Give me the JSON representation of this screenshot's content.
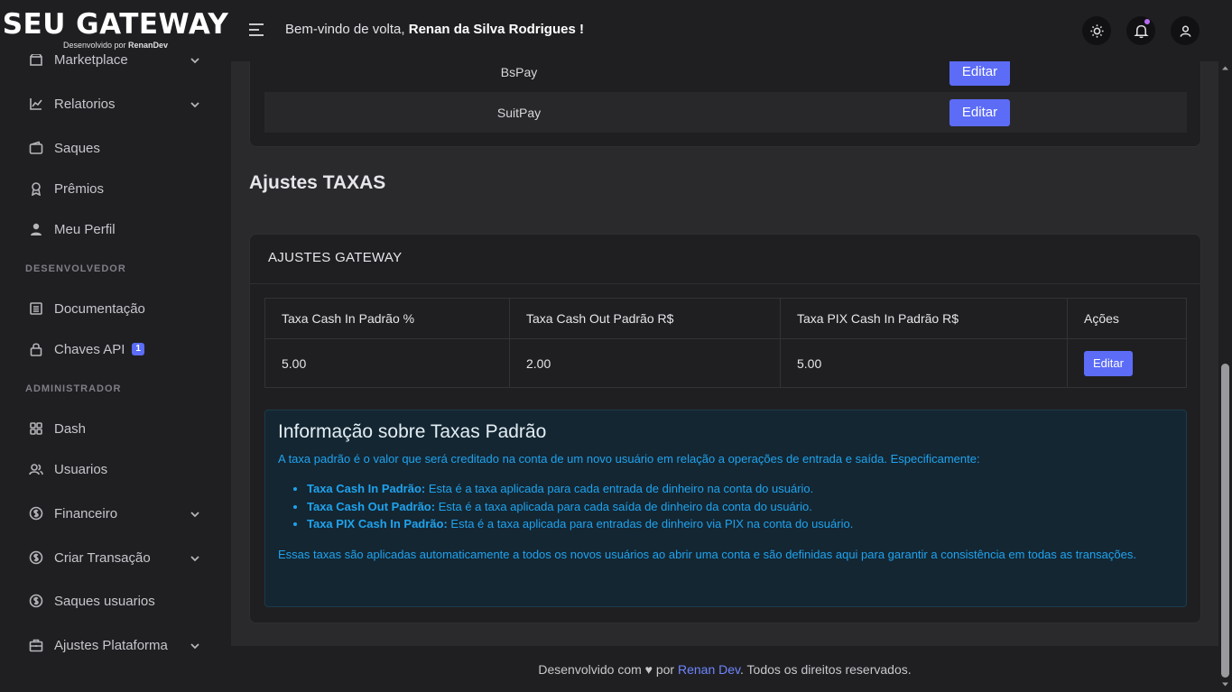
{
  "brand": {
    "title": "SEU GATEWAY",
    "subtitle_prefix": "Desenvolvido por ",
    "subtitle_author": "RenanDev"
  },
  "sidebar": {
    "items": [
      {
        "label": "Marketplace",
        "icon": "store-icon",
        "has_chevron": true
      },
      {
        "label": "Relatorios",
        "icon": "chart-line-icon",
        "has_chevron": true
      },
      {
        "label": "Saques",
        "icon": "wallet-icon",
        "has_chevron": false
      },
      {
        "label": "Prêmios",
        "icon": "award-icon",
        "has_chevron": false
      },
      {
        "label": "Meu Perfil",
        "icon": "user-icon",
        "has_chevron": false
      }
    ],
    "section_dev": "DESENVOLVEDOR",
    "dev_items": [
      {
        "label": "Documentação",
        "icon": "document-icon"
      },
      {
        "label": "Chaves API",
        "icon": "lock-icon",
        "badge": "1"
      }
    ],
    "section_admin": "ADMINISTRADOR",
    "admin_items": [
      {
        "label": "Dash",
        "icon": "grid-icon",
        "has_chevron": false
      },
      {
        "label": "Usuarios",
        "icon": "users-icon",
        "has_chevron": false
      },
      {
        "label": "Financeiro",
        "icon": "dollar-circle-icon",
        "has_chevron": true
      },
      {
        "label": "Criar Transação",
        "icon": "dollar-circle-icon",
        "has_chevron": true
      },
      {
        "label": "Saques usuarios",
        "icon": "dollar-circle-icon",
        "has_chevron": false
      },
      {
        "label": "Ajustes Plataforma",
        "icon": "briefcase-icon",
        "has_chevron": true
      }
    ]
  },
  "topbar": {
    "welcome_prefix": "Bem-vindo de volta, ",
    "user_name": "Renan da Silva Rodrigues",
    "welcome_suffix": " !"
  },
  "gateways": [
    {
      "name": "BsPay",
      "action": "Editar"
    },
    {
      "name": "SuitPay",
      "action": "Editar"
    }
  ],
  "page_heading": "Ajustes TAXAS",
  "fees_card": {
    "title": "AJUSTES GATEWAY",
    "headers": [
      "Taxa Cash In Padrão %",
      "Taxa Cash Out Padrão R$",
      "Taxa PIX Cash In Padrão R$",
      "Ações"
    ],
    "row": [
      "5.00",
      "2.00",
      "5.00"
    ],
    "action": "Editar"
  },
  "info": {
    "title": "Informação sobre Taxas Padrão",
    "intro": "A taxa padrão é o valor que será creditado na conta de um novo usuário em relação a operações de entrada e saída. Especificamente:",
    "items": [
      {
        "term": "Taxa Cash In Padrão:",
        "text": " Esta é a taxa aplicada para cada entrada de dinheiro na conta do usuário."
      },
      {
        "term": "Taxa Cash Out Padrão:",
        "text": " Esta é a taxa aplicada para cada saída de dinheiro da conta do usuário."
      },
      {
        "term": "Taxa PIX Cash In Padrão:",
        "text": " Esta é a taxa aplicada para entradas de dinheiro via PIX na conta do usuário."
      }
    ],
    "outro": "Essas taxas são aplicadas automaticamente a todos os novos usuários ao abrir uma conta e são definidas aqui para garantir a consistência em todas as transações."
  },
  "footer": {
    "prefix": "Desenvolvido com",
    "heart": "♥",
    "by": " por ",
    "author": "Renan Dev",
    "suffix": ". Todos os direitos reservados."
  },
  "colors": {
    "accent": "#5c6cf7",
    "info_text": "#1fa3ee",
    "background": "#2a2a2d",
    "panel": "#1f1f22"
  }
}
